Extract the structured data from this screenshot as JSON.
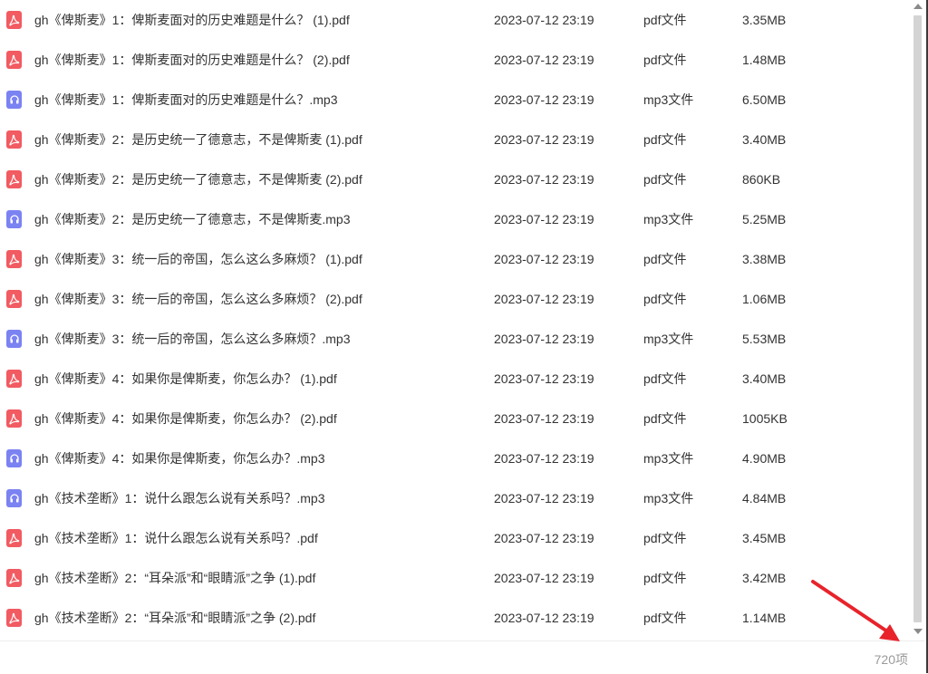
{
  "files": [
    {
      "name": "gh《俾斯麦》1：俾斯麦面对的历史难题是什么？ (1).pdf",
      "date": "2023-07-12 23:19",
      "type": "pdf文件",
      "size": "3.35MB",
      "kind": "pdf"
    },
    {
      "name": "gh《俾斯麦》1：俾斯麦面对的历史难题是什么？ (2).pdf",
      "date": "2023-07-12 23:19",
      "type": "pdf文件",
      "size": "1.48MB",
      "kind": "pdf"
    },
    {
      "name": "gh《俾斯麦》1：俾斯麦面对的历史难题是什么？.mp3",
      "date": "2023-07-12 23:19",
      "type": "mp3文件",
      "size": "6.50MB",
      "kind": "mp3"
    },
    {
      "name": "gh《俾斯麦》2：是历史统一了德意志，不是俾斯麦 (1).pdf",
      "date": "2023-07-12 23:19",
      "type": "pdf文件",
      "size": "3.40MB",
      "kind": "pdf"
    },
    {
      "name": "gh《俾斯麦》2：是历史统一了德意志，不是俾斯麦 (2).pdf",
      "date": "2023-07-12 23:19",
      "type": "pdf文件",
      "size": "860KB",
      "kind": "pdf"
    },
    {
      "name": "gh《俾斯麦》2：是历史统一了德意志，不是俾斯麦.mp3",
      "date": "2023-07-12 23:19",
      "type": "mp3文件",
      "size": "5.25MB",
      "kind": "mp3"
    },
    {
      "name": "gh《俾斯麦》3：统一后的帝国，怎么这么多麻烦？ (1).pdf",
      "date": "2023-07-12 23:19",
      "type": "pdf文件",
      "size": "3.38MB",
      "kind": "pdf"
    },
    {
      "name": "gh《俾斯麦》3：统一后的帝国，怎么这么多麻烦？ (2).pdf",
      "date": "2023-07-12 23:19",
      "type": "pdf文件",
      "size": "1.06MB",
      "kind": "pdf"
    },
    {
      "name": "gh《俾斯麦》3：统一后的帝国，怎么这么多麻烦？.mp3",
      "date": "2023-07-12 23:19",
      "type": "mp3文件",
      "size": "5.53MB",
      "kind": "mp3"
    },
    {
      "name": "gh《俾斯麦》4：如果你是俾斯麦，你怎么办？ (1).pdf",
      "date": "2023-07-12 23:19",
      "type": "pdf文件",
      "size": "3.40MB",
      "kind": "pdf"
    },
    {
      "name": "gh《俾斯麦》4：如果你是俾斯麦，你怎么办？ (2).pdf",
      "date": "2023-07-12 23:19",
      "type": "pdf文件",
      "size": "1005KB",
      "kind": "pdf"
    },
    {
      "name": "gh《俾斯麦》4：如果你是俾斯麦，你怎么办？.mp3",
      "date": "2023-07-12 23:19",
      "type": "mp3文件",
      "size": "4.90MB",
      "kind": "mp3"
    },
    {
      "name": "gh《技术垄断》1：说什么跟怎么说有关系吗？.mp3",
      "date": "2023-07-12 23:19",
      "type": "mp3文件",
      "size": "4.84MB",
      "kind": "mp3"
    },
    {
      "name": "gh《技术垄断》1：说什么跟怎么说有关系吗？.pdf",
      "date": "2023-07-12 23:19",
      "type": "pdf文件",
      "size": "3.45MB",
      "kind": "pdf"
    },
    {
      "name": "gh《技术垄断》2：“耳朵派”和“眼睛派”之争 (1).pdf",
      "date": "2023-07-12 23:19",
      "type": "pdf文件",
      "size": "3.42MB",
      "kind": "pdf"
    },
    {
      "name": "gh《技术垄断》2：“耳朵派”和“眼睛派”之争 (2).pdf",
      "date": "2023-07-12 23:19",
      "type": "pdf文件",
      "size": "1.14MB",
      "kind": "pdf"
    }
  ],
  "footer": {
    "item_count": "720项"
  },
  "icons": {
    "pdf": "pdf-icon",
    "mp3": "headphones-icon"
  },
  "colors": {
    "pdf_icon": "#f15b61",
    "mp3_icon": "#7b82f2",
    "annotation_arrow": "#e8232b"
  }
}
